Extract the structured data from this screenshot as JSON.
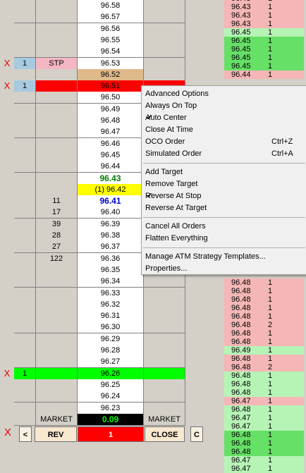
{
  "ladder": {
    "rows": [
      {
        "x": "",
        "qty": "",
        "bid": "",
        "price": "96.58",
        "ask": ""
      },
      {
        "x": "",
        "qty": "",
        "bid": "",
        "price": "96.57",
        "ask": ""
      },
      {
        "x": "",
        "qty": "",
        "bid": "",
        "price": "96.56",
        "ask": ""
      },
      {
        "x": "",
        "qty": "",
        "bid": "",
        "price": "96.55",
        "ask": ""
      },
      {
        "x": "",
        "qty": "",
        "bid": "",
        "price": "96.54",
        "ask": ""
      },
      {
        "x": "X",
        "qty": "1",
        "bid": "STP",
        "price": "96.53",
        "ask": ""
      },
      {
        "x": "",
        "qty": "",
        "bid": "",
        "price": "96.52",
        "ask": ""
      },
      {
        "x": "X",
        "qty": "1",
        "bid": "",
        "price": "96.51",
        "ask": ""
      },
      {
        "x": "",
        "qty": "",
        "bid": "",
        "price": "96.50",
        "ask": ""
      },
      {
        "x": "",
        "qty": "",
        "bid": "",
        "price": "96.49",
        "ask": ""
      },
      {
        "x": "",
        "qty": "",
        "bid": "",
        "price": "96.48",
        "ask": ""
      },
      {
        "x": "",
        "qty": "",
        "bid": "",
        "price": "96.47",
        "ask": ""
      },
      {
        "x": "",
        "qty": "",
        "bid": "",
        "price": "96.46",
        "ask": ""
      },
      {
        "x": "",
        "qty": "",
        "bid": "",
        "price": "96.45",
        "ask": ""
      },
      {
        "x": "",
        "qty": "",
        "bid": "",
        "price": "96.44",
        "ask": ""
      },
      {
        "x": "",
        "qty": "",
        "bid": "",
        "price": "96.43",
        "ask": ""
      },
      {
        "x": "",
        "qty": "",
        "bid": "",
        "price": "(1) 96.42",
        "ask": ""
      },
      {
        "x": "",
        "qty": "",
        "bid": "11",
        "price": "96.41",
        "ask": ""
      },
      {
        "x": "",
        "qty": "",
        "bid": "17",
        "price": "96.40",
        "ask": ""
      },
      {
        "x": "",
        "qty": "",
        "bid": "39",
        "price": "96.39",
        "ask": ""
      },
      {
        "x": "",
        "qty": "",
        "bid": "28",
        "price": "96.38",
        "ask": ""
      },
      {
        "x": "",
        "qty": "",
        "bid": "27",
        "price": "96.37",
        "ask": ""
      },
      {
        "x": "",
        "qty": "",
        "bid": "122",
        "price": "96.36",
        "ask": ""
      },
      {
        "x": "",
        "qty": "",
        "bid": "",
        "price": "96.35",
        "ask": ""
      },
      {
        "x": "",
        "qty": "",
        "bid": "",
        "price": "96.34",
        "ask": ""
      },
      {
        "x": "",
        "qty": "",
        "bid": "",
        "price": "96.33",
        "ask": ""
      },
      {
        "x": "",
        "qty": "",
        "bid": "",
        "price": "96.32",
        "ask": ""
      },
      {
        "x": "",
        "qty": "",
        "bid": "",
        "price": "96.31",
        "ask": ""
      },
      {
        "x": "",
        "qty": "",
        "bid": "",
        "price": "96.30",
        "ask": ""
      },
      {
        "x": "",
        "qty": "",
        "bid": "",
        "price": "96.29",
        "ask": ""
      },
      {
        "x": "",
        "qty": "",
        "bid": "",
        "price": "96.28",
        "ask": ""
      },
      {
        "x": "",
        "qty": "",
        "bid": "",
        "price": "96.27",
        "ask": ""
      },
      {
        "x": "X",
        "qty": "1",
        "bid": "",
        "price": "96.26",
        "ask": ""
      },
      {
        "x": "",
        "qty": "",
        "bid": "",
        "price": "96.25",
        "ask": ""
      },
      {
        "x": "",
        "qty": "",
        "bid": "",
        "price": "96.24",
        "ask": ""
      },
      {
        "x": "",
        "qty": "",
        "bid": "",
        "price": "96.23",
        "ask": ""
      },
      {
        "x": "",
        "qty": "",
        "bid": "MARKET",
        "price": "0.09",
        "ask": "MARKET"
      }
    ],
    "highlights": {
      "stop_qty_bg": "#a6cae0",
      "stop_label_bg": "#f4b6c2",
      "tan_bg": "#e0b98a",
      "red_bg": "#ff0000",
      "yellow_bg": "#ffff00",
      "green_bg": "#00ff00",
      "last_price_color": "#008000",
      "best_bid_color": "#0000cc",
      "net_change_color": "#00ff00"
    }
  },
  "tape_top": [
    {
      "price": "96.43",
      "vol": "1",
      "color": "#f4b6b6"
    },
    {
      "price": "96.43",
      "vol": "1",
      "color": "#f4b6b6"
    },
    {
      "price": "96.43",
      "vol": "1",
      "color": "#f4b6b6"
    },
    {
      "price": "96.43",
      "vol": "1",
      "color": "#f4b6b6"
    },
    {
      "price": "96.45",
      "vol": "1",
      "color": "#b6f4b6"
    },
    {
      "price": "96.45",
      "vol": "1",
      "color": "#66e066"
    },
    {
      "price": "96.45",
      "vol": "1",
      "color": "#66e066"
    },
    {
      "price": "96.45",
      "vol": "1",
      "color": "#66e066"
    },
    {
      "price": "96.45",
      "vol": "1",
      "color": "#66e066"
    },
    {
      "price": "96.44",
      "vol": "1",
      "color": "#f4b6b6"
    }
  ],
  "tape_bottom": [
    {
      "price": "96.48",
      "vol": "1",
      "color": "#f4b6b6"
    },
    {
      "price": "96.48",
      "vol": "1",
      "color": "#f4b6b6"
    },
    {
      "price": "96.48",
      "vol": "1",
      "color": "#f4b6b6"
    },
    {
      "price": "96.48",
      "vol": "1",
      "color": "#f4b6b6"
    },
    {
      "price": "96.48",
      "vol": "1",
      "color": "#f4b6b6"
    },
    {
      "price": "96.48",
      "vol": "2",
      "color": "#f4b6b6"
    },
    {
      "price": "96.48",
      "vol": "1",
      "color": "#f4b6b6"
    },
    {
      "price": "96.48",
      "vol": "1",
      "color": "#f4b6b6"
    },
    {
      "price": "96.49",
      "vol": "1",
      "color": "#b6f4b6"
    },
    {
      "price": "96.48",
      "vol": "1",
      "color": "#f4b6b6"
    },
    {
      "price": "96.48",
      "vol": "2",
      "color": "#f4b6b6"
    },
    {
      "price": "96.48",
      "vol": "1",
      "color": "#b6f4b6"
    },
    {
      "price": "96.48",
      "vol": "1",
      "color": "#b6f4b6"
    },
    {
      "price": "96.48",
      "vol": "1",
      "color": "#b6f4b6"
    },
    {
      "price": "96.47",
      "vol": "1",
      "color": "#f4b6b6"
    },
    {
      "price": "96.48",
      "vol": "1",
      "color": "#b6f4b6"
    },
    {
      "price": "96.47",
      "vol": "1",
      "color": "#b6f4b6"
    },
    {
      "price": "96.47",
      "vol": "1",
      "color": "#b6f4b6"
    },
    {
      "price": "96.48",
      "vol": "1",
      "color": "#66e066"
    },
    {
      "price": "96.48",
      "vol": "1",
      "color": "#66e066"
    },
    {
      "price": "96.48",
      "vol": "1",
      "color": "#66e066"
    },
    {
      "price": "96.47",
      "vol": "1",
      "color": "#b6f4b6"
    },
    {
      "price": "96.47",
      "vol": "1",
      "color": "#b6f4b6"
    }
  ],
  "menu": {
    "items": [
      {
        "label": "Advanced Options",
        "checked": false,
        "shortcut": "",
        "highlighted": true
      },
      {
        "label": "Always On Top",
        "checked": false,
        "shortcut": ""
      },
      {
        "label": "Auto Center",
        "checked": true,
        "shortcut": ""
      },
      {
        "label": "Close At Time",
        "checked": false,
        "shortcut": ""
      },
      {
        "label": "OCO Order",
        "checked": false,
        "shortcut": "Ctrl+Z"
      },
      {
        "label": "Simulated Order",
        "checked": false,
        "shortcut": "Ctrl+A"
      },
      {
        "sep": true
      },
      {
        "label": "Add Target",
        "checked": false,
        "shortcut": ""
      },
      {
        "label": "Remove Target",
        "checked": false,
        "shortcut": ""
      },
      {
        "label": "Reverse At Stop",
        "checked": true,
        "shortcut": ""
      },
      {
        "label": "Reverse At Target",
        "checked": false,
        "shortcut": ""
      },
      {
        "sep": true
      },
      {
        "label": "Cancel All Orders",
        "checked": false,
        "shortcut": ""
      },
      {
        "label": "Flatten Everything",
        "checked": false,
        "shortcut": ""
      },
      {
        "sep": true
      },
      {
        "label": "Manage ATM Strategy Templates...",
        "checked": false,
        "shortcut": ""
      },
      {
        "label": "Properties...",
        "checked": false,
        "shortcut": ""
      }
    ]
  },
  "bottom": {
    "x": "X",
    "left_arrow": "<",
    "rev": "REV",
    "position": "1",
    "close": "CLOSE",
    "c": "C"
  }
}
